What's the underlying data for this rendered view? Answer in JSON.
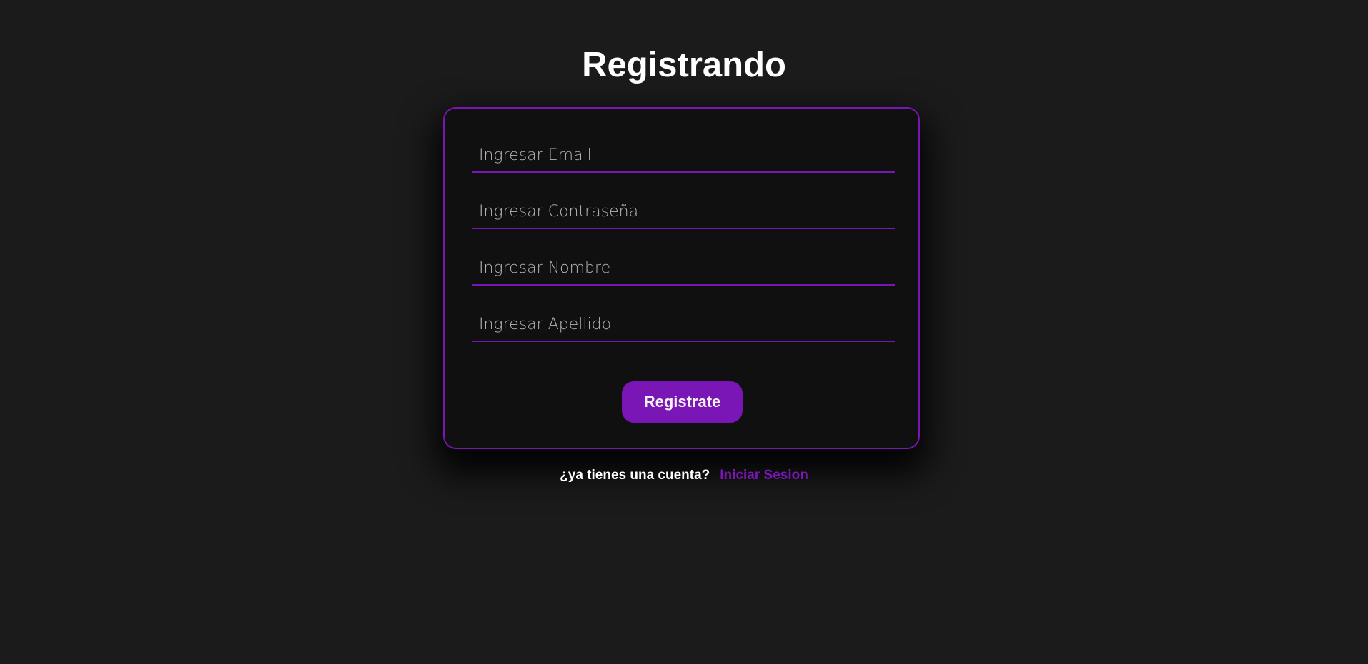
{
  "page": {
    "title": "Registrando"
  },
  "form": {
    "email_placeholder": "Ingresar Email",
    "password_placeholder": "Ingresar Contraseña",
    "name_placeholder": "Ingresar Nombre",
    "lastname_placeholder": "Ingresar Apellido",
    "submit_label": "Registrate"
  },
  "footer": {
    "question": "¿ya tienes una cuenta?",
    "login_link": "Iniciar Sesion"
  },
  "colors": {
    "background": "#1b1b1b",
    "card": "#101010",
    "accent": "#7a16b5",
    "text": "#ffffff"
  }
}
